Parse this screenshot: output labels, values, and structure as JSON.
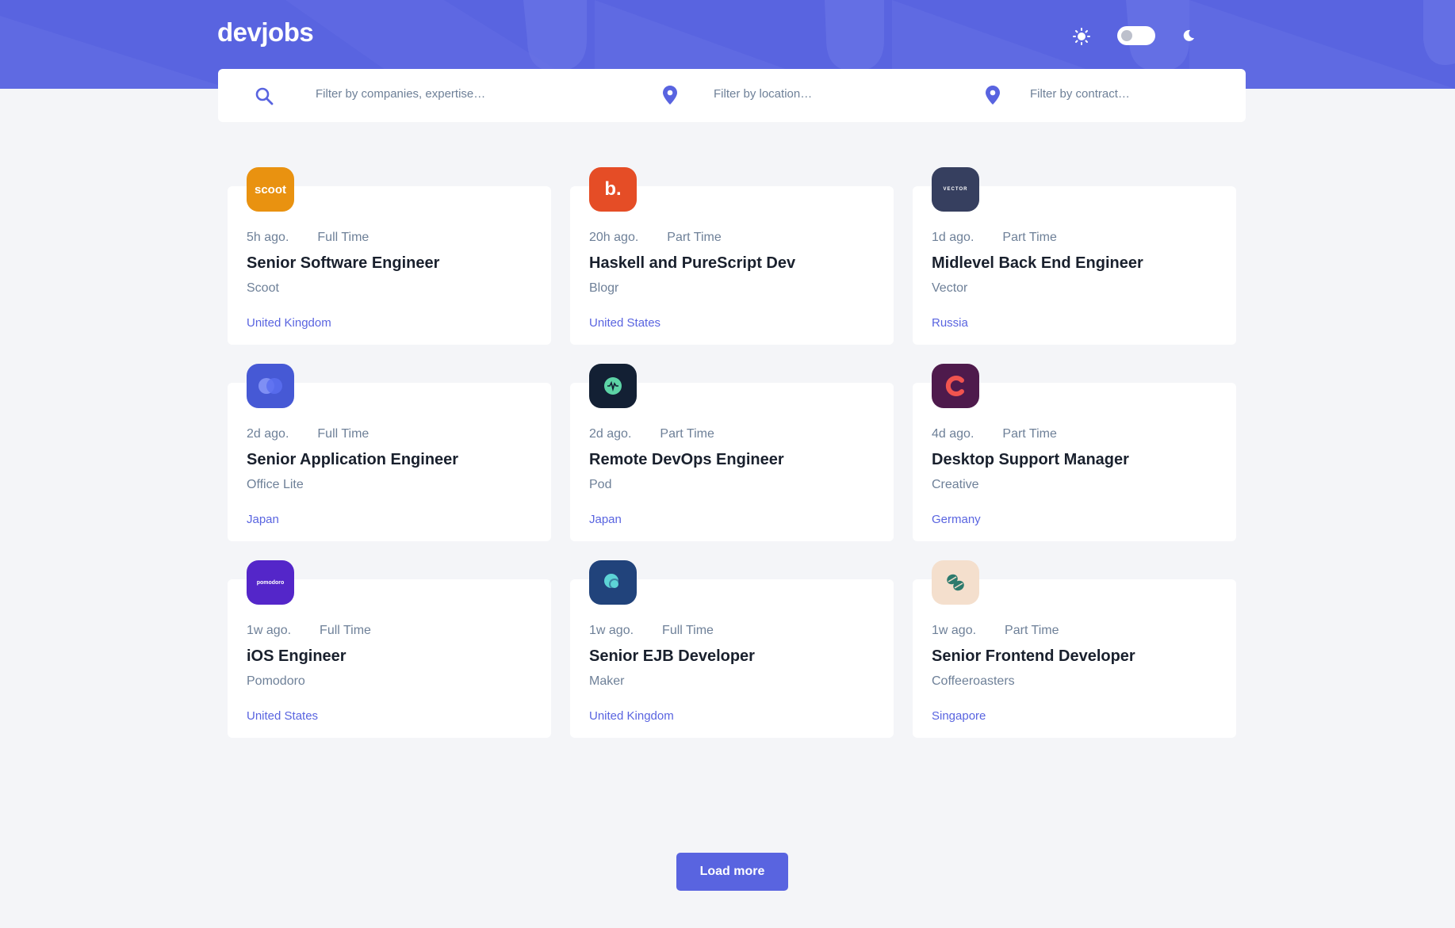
{
  "header": {
    "logo": "devjobs",
    "theme_icons": {
      "light": "sun-icon",
      "dark": "moon-icon"
    },
    "theme_toggle_state": "light"
  },
  "filters": {
    "title": {
      "icon": "search-icon",
      "placeholder": "Filter by companies, expertise…"
    },
    "location": {
      "icon": "location-pin-icon",
      "placeholder": "Filter by location…"
    },
    "contract": {
      "icon": "location-pin-icon",
      "placeholder": "Filter by contract…"
    }
  },
  "jobs": [
    {
      "posted": "5h ago.",
      "contract": "Full Time",
      "position": "Senior Software Engineer",
      "company": "Scoot",
      "location": "United Kingdom",
      "logo_text": "scoot",
      "logo_color": "#e99210"
    },
    {
      "posted": "20h ago.",
      "contract": "Part Time",
      "position": "Haskell and PureScript Dev",
      "company": "Blogr",
      "location": "United States",
      "logo_text": "b.",
      "logo_color": "#e54d26"
    },
    {
      "posted": "1d ago.",
      "contract": "Part Time",
      "position": "Midlevel Back End Engineer",
      "company": "Vector",
      "location": "Russia",
      "logo_text": "VECTOR",
      "logo_color": "#363f5f"
    },
    {
      "posted": "2d ago.",
      "contract": "Full Time",
      "position": "Senior Application Engineer",
      "company": "Office Lite",
      "location": "Japan",
      "logo_color": "#4659d5"
    },
    {
      "posted": "2d ago.",
      "contract": "Part Time",
      "position": "Remote DevOps Engineer",
      "company": "Pod",
      "location": "Japan",
      "logo_color": "#132034"
    },
    {
      "posted": "4d ago.",
      "contract": "Part Time",
      "position": "Desktop Support Manager",
      "company": "Creative",
      "location": "Germany",
      "logo_color": "#4e1a4c"
    },
    {
      "posted": "1w ago.",
      "contract": "Full Time",
      "position": "iOS Engineer",
      "company": "Pomodoro",
      "location": "United States",
      "logo_text": "pomodoro",
      "logo_color": "#5426c9"
    },
    {
      "posted": "1w ago.",
      "contract": "Full Time",
      "position": "Senior EJB Developer",
      "company": "Maker",
      "location": "United Kingdom",
      "logo_color": "#21437b"
    },
    {
      "posted": "1w ago.",
      "contract": "Part Time",
      "position": "Senior Frontend Developer",
      "company": "Coffeeroasters",
      "location": "Singapore",
      "logo_color": "#f4dfcd"
    }
  ],
  "load_more": "Load more",
  "colors": {
    "accent": "#5964e0",
    "background": "#f4f5f8",
    "text_gray": "#6e8098",
    "title": "#19202d"
  }
}
